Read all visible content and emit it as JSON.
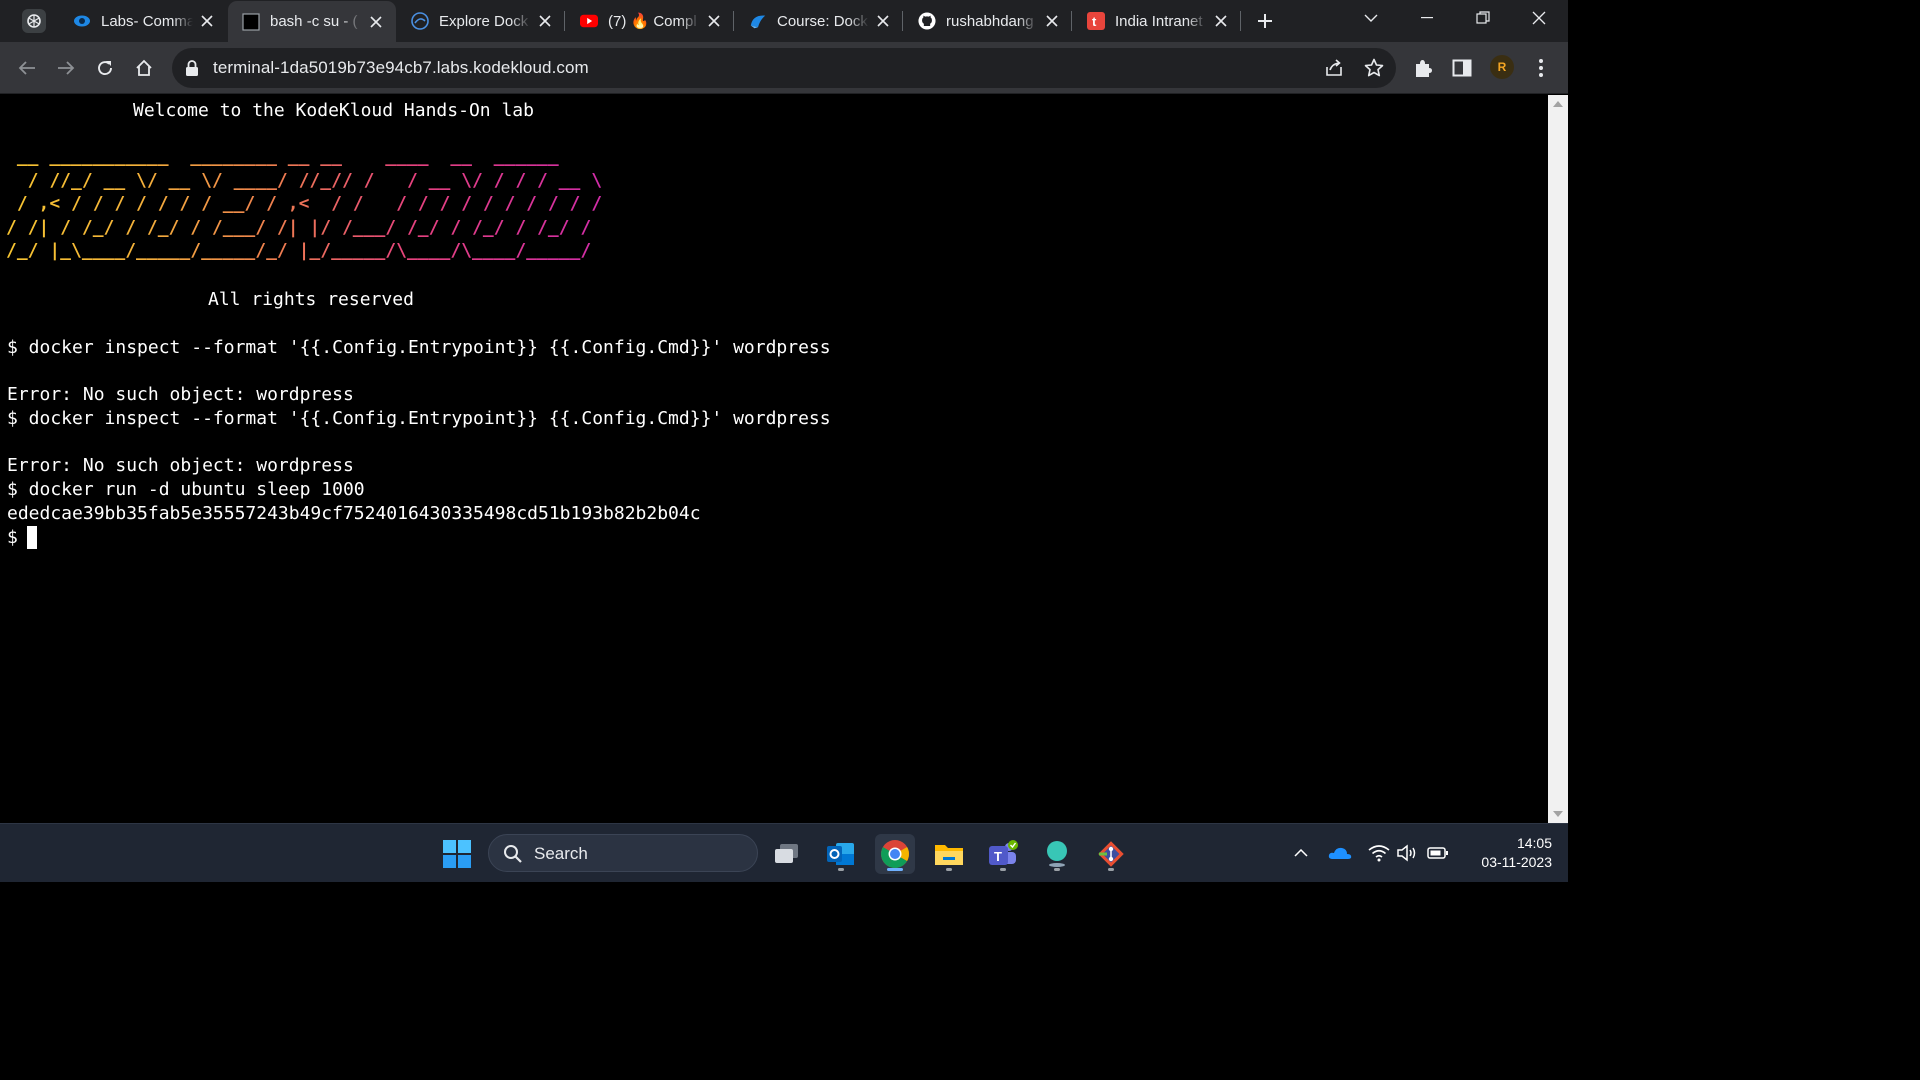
{
  "browser": {
    "tabs": [
      {
        "title": "Labs- Comma",
        "icon": "kodekloud-eye-icon",
        "active": false
      },
      {
        "title": "bash -c su - (",
        "icon": "terminal-icon",
        "active": true
      },
      {
        "title": "Explore Dock",
        "icon": "docker-hub-icon",
        "active": false
      },
      {
        "title": "(7) 🔥 Compl",
        "icon": "youtube-icon",
        "active": false
      },
      {
        "title": "Course: Dock",
        "icon": "kodekloud-course-icon",
        "active": false
      },
      {
        "title": "rushabhdang",
        "icon": "github-icon",
        "active": false
      },
      {
        "title": "India Intranet",
        "icon": "intranet-t-icon",
        "active": false
      }
    ],
    "url": "terminal-1da5019b73e94cb7.labs.kodekloud.com"
  },
  "terminal": {
    "welcome": "Welcome to the KodeKloud Hands-On lab",
    "banner_art": " __ ___________  ________ __ __    ____  __  ______\n  / //_/ __ \\/ __ \\/ ____/ //_// /   / __ \\/ / / / __ \\\n / ,< / / / / / / / __/ / ,<  / /   / / / / / / / / / /\n/ /| / /_/ / /_/ / /___/ /| |/ /___/ /_/ / /_/ / /_/ /\n/_/ |_\\____/_____/_____/_/ |_/_____/\\____/\\____/_____/",
    "rights": "All rights reserved",
    "lines": [
      "$ docker inspect --format '{{.Config.Entrypoint}} {{.Config.Cmd}}' wordpress",
      "",
      "Error: No such object: wordpress",
      "$ docker inspect --format '{{.Config.Entrypoint}} {{.Config.Cmd}}' wordpress",
      "",
      "Error: No such object: wordpress",
      "$ docker run -d ubuntu sleep 1000",
      "ededcae39bb35fab5e35557243b49cf7524016430335498cd51b193b82b2b04c"
    ],
    "prompt": "$"
  },
  "taskbar": {
    "search_label": "Search",
    "time": "14:05",
    "date": "03-11-2023",
    "apps": [
      "start-icon",
      "task-view-icon",
      "outlook-icon",
      "chrome-icon",
      "file-explorer-icon",
      "teams-icon",
      "bubble-app-icon",
      "git-icon"
    ]
  },
  "colors": {
    "tabstrip": "#202124",
    "toolbar": "#35363a",
    "terminal_bg": "#000000",
    "art_gradient_start": "#f7c531",
    "art_gradient_end": "#d12ca8",
    "taskbar": "#1f2633"
  }
}
